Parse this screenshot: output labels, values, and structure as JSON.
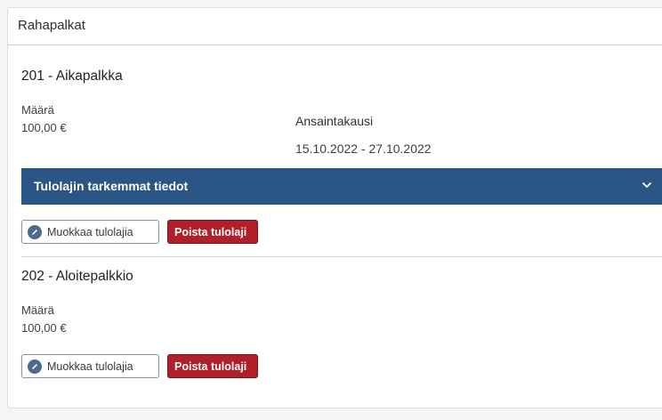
{
  "section": {
    "title": "Rahapalkat"
  },
  "items": [
    {
      "heading": "201 - Aikapalkka",
      "amount_label": "Määrä",
      "amount_value": "100,00 €",
      "period_label": "Ansaintakausi",
      "period_value": "15.10.2022 - 27.10.2022",
      "details_toggle_label": "Tulolajin tarkemmat tiedot",
      "edit_label": "Muokkaa tulolajia",
      "delete_label": "Poista tulolaji"
    },
    {
      "heading": "202 - Aloitepalkkio",
      "amount_label": "Määrä",
      "amount_value": "100,00 €",
      "edit_label": "Muokkaa tulolajia",
      "delete_label": "Poista tulolaji"
    }
  ],
  "icons": {
    "edit": "pencil-icon",
    "toggle": "chevron-down-icon"
  },
  "colors": {
    "accordion_bg": "#2b5584",
    "delete_button_bg": "#b0202a",
    "edit_icon_bg": "#4d6a8d"
  }
}
